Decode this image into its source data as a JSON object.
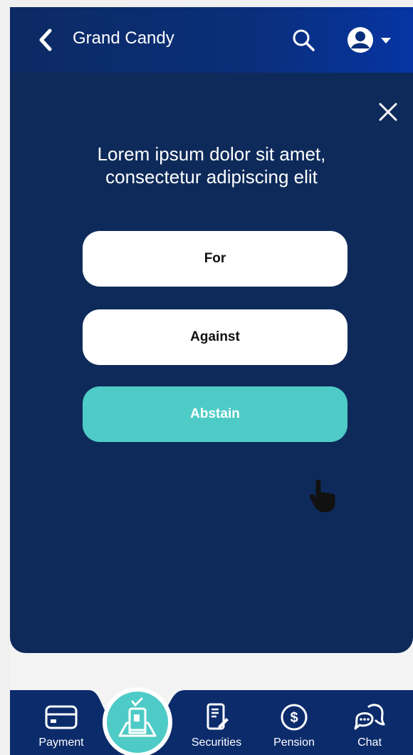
{
  "header": {
    "title": "Grand Candy"
  },
  "modal": {
    "prompt_line1": "Lorem ipsum dolor sit amet,",
    "prompt_line2": "consectetur adipiscing elit",
    "options": [
      {
        "label": "For"
      },
      {
        "label": "Against"
      },
      {
        "label": "Abstain"
      }
    ]
  },
  "nav": {
    "items": [
      {
        "label": "Payment",
        "icon": "card-icon"
      },
      {
        "label": "",
        "icon": "vote-ballot-icon"
      },
      {
        "label": "Securities",
        "icon": "document-pen-icon"
      },
      {
        "label": "Pension",
        "icon": "dollar-coin-icon"
      },
      {
        "label": "Chat",
        "icon": "chat-bubbles-icon"
      }
    ]
  },
  "colors": {
    "header": "#0a2f7a",
    "modal_bg": "#0e2a5a",
    "accent": "#4ecbc6",
    "button_bg": "#ffffff",
    "nav_bg": "#0b2b6b"
  }
}
